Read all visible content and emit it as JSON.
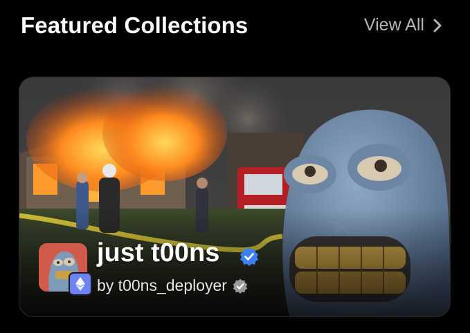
{
  "header": {
    "title": "Featured Collections",
    "view_all_label": "View All",
    "view_all_icon": "chevron-right-icon"
  },
  "featured": {
    "collection_name": "just t00ns",
    "creator_text": "by t00ns_deployer",
    "verified_icon": "verified-badge-icon",
    "creator_verified_icon": "creator-verified-badge-icon",
    "chain_icon": "ethereum-icon",
    "colors": {
      "verified_blue": "#3d7ff5",
      "chain_badge": "#6b84f2",
      "creator_badge": "#9a9a9a"
    }
  }
}
